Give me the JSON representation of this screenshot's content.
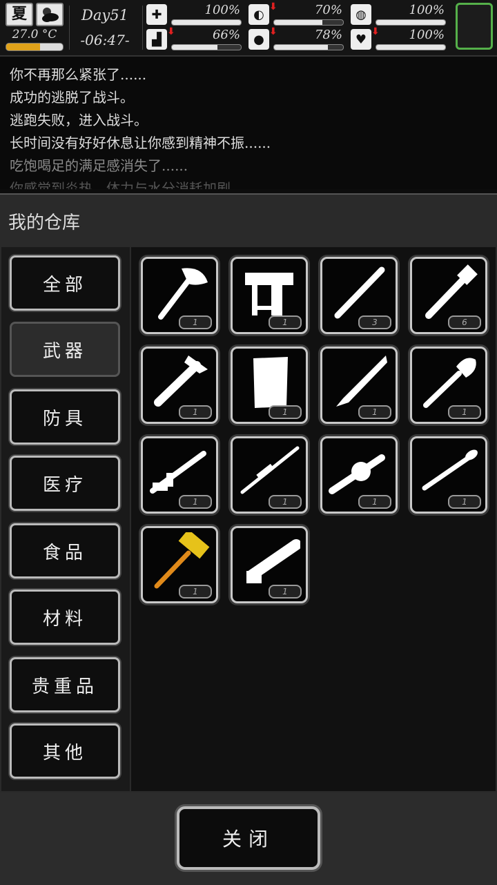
{
  "status": {
    "season": "夏",
    "weather_icon": "partly-cloudy-icon",
    "temperature": "27.0 °C",
    "temperature_level": 0.6,
    "day": "Day51",
    "time": "-06:47-",
    "stats": [
      {
        "icon": "medkit-icon",
        "glyph": "✚",
        "value": "100%",
        "level": 1.0,
        "down": false
      },
      {
        "icon": "stomach-icon",
        "glyph": "◐",
        "value": "70%",
        "level": 0.7,
        "down": true
      },
      {
        "icon": "mental-icon",
        "glyph": "◍",
        "value": "100%",
        "level": 1.0,
        "down": false
      },
      {
        "icon": "foot-icon",
        "glyph": "▟",
        "value": "66%",
        "level": 0.66,
        "down": true
      },
      {
        "icon": "water-drop-icon",
        "glyph": "●",
        "value": "78%",
        "level": 0.78,
        "down": true
      },
      {
        "icon": "heart-icon",
        "glyph": "♥",
        "value": "100%",
        "level": 1.0,
        "down": true
      }
    ]
  },
  "log": [
    "你不再那么紧张了......",
    "成功的逃脱了战斗。",
    "逃跑失败，进入战斗。",
    "长时间没有好好休息让你感到精神不振......",
    "吃饱喝足的满足感消失了......",
    "你感觉到炎热，体力与水分消耗加剧"
  ],
  "warehouse": {
    "title": "我的仓库",
    "categories": [
      "全部",
      "武器",
      "防具",
      "医疗",
      "食品",
      "材料",
      "贵重品",
      "其他"
    ],
    "active_category": "武器",
    "items": [
      {
        "icon": "axe-icon",
        "count": "1"
      },
      {
        "icon": "nail-gun-icon",
        "count": "1"
      },
      {
        "icon": "wooden-club-icon",
        "count": "3"
      },
      {
        "icon": "pipe-wrench-icon",
        "count": "6"
      },
      {
        "icon": "ice-axe-icon",
        "count": "1"
      },
      {
        "icon": "wooden-board-icon",
        "count": "1"
      },
      {
        "icon": "machete-icon",
        "count": "1"
      },
      {
        "icon": "shovel-icon",
        "count": "1"
      },
      {
        "icon": "assault-rifle-icon",
        "count": "1"
      },
      {
        "icon": "sniper-rifle-icon",
        "count": "1"
      },
      {
        "icon": "grenade-launcher-icon",
        "count": "1"
      },
      {
        "icon": "rocket-launcher-icon",
        "count": "1"
      },
      {
        "icon": "golden-hammer-icon",
        "count": "1"
      },
      {
        "icon": "minigun-icon",
        "count": "1"
      }
    ],
    "close_label": "关闭"
  }
}
